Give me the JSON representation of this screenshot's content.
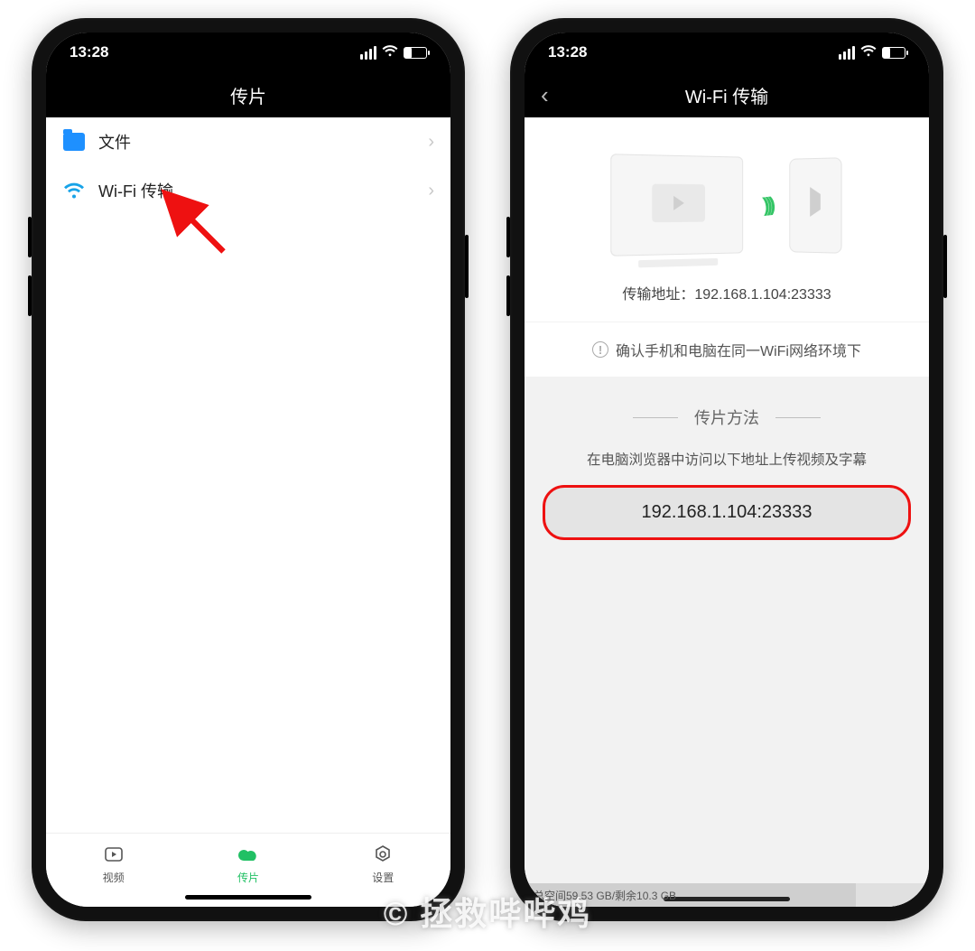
{
  "status": {
    "time": "13:28"
  },
  "left": {
    "title": "传片",
    "rows": [
      {
        "label": "文件"
      },
      {
        "label": "Wi-Fi 传输"
      }
    ],
    "tabs": {
      "video": "视频",
      "transfer": "传片",
      "settings": "设置"
    }
  },
  "right": {
    "title": "Wi-Fi 传输",
    "addr_label": "传输地址：",
    "addr_value": "192.168.1.104:23333",
    "note": "确认手机和电脑在同一WiFi网络环境下",
    "method_title": "传片方法",
    "method_desc": "在电脑浏览器中访问以下地址上传视频及字幕",
    "ip": "192.168.1.104:23333",
    "storage": "总空间59.53 GB/剩余10.3 GB"
  },
  "watermark": "© 拯救哔哔鸡"
}
